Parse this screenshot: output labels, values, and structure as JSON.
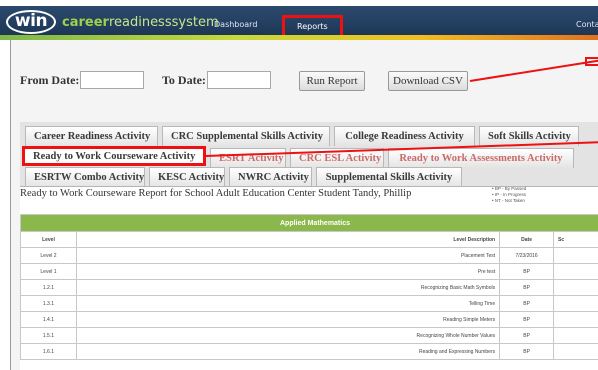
{
  "header": {
    "logo_text": "win",
    "brand_bold": "career",
    "brand_rest": "readinesssystem",
    "nav": [
      "Dashboard",
      "Reports",
      "Conta"
    ]
  },
  "filters": {
    "from_label": "From Date:",
    "to_label": "To Date:",
    "from_value": "",
    "to_value": "",
    "run_label": "Run Report",
    "csv_label": "Download CSV"
  },
  "tabs": {
    "row1": [
      "Career Readiness Activity",
      "CRC Supplemental Skills Activity",
      "College Readiness Activity",
      "Soft Skills Activity"
    ],
    "row2": [
      "Ready to Work Courseware Activity",
      "ESRT Activity",
      "CRC ESL Activity",
      "Ready to Work Assessments Activity"
    ],
    "row3": [
      "ESRTW Combo Activity",
      "KESC Activity",
      "NWRC Activity",
      "Supplemental Skills Activity"
    ]
  },
  "report": {
    "title": "Ready to Work Courseware Report for School Adult Education Center Student Tandy, Phillip",
    "legend": [
      "• BP - By Passed",
      "• IP - In Progress",
      "• NT - Not Taken"
    ]
  },
  "table": {
    "section": "Applied Mathematics",
    "headers": [
      "Level",
      "Level Description",
      "Date",
      "Sc"
    ],
    "rows": [
      {
        "level": "Level 2",
        "desc": "Placement Test",
        "date": "7/23/2016"
      },
      {
        "level": "Level 1",
        "desc": "Pre test",
        "date": "BP"
      },
      {
        "level": "1.2.1",
        "desc": "Recognizing Basic Math Symbols",
        "date": "BP"
      },
      {
        "level": "1.3.1",
        "desc": "Telling Time",
        "date": "BP"
      },
      {
        "level": "1.4.1",
        "desc": "Reading Simple Meters",
        "date": "BP"
      },
      {
        "level": "1.5.1",
        "desc": "Recognizing Whole Number Values",
        "date": "BP"
      },
      {
        "level": "1.6.1",
        "desc": "Reading and Expressing Numbers",
        "date": "BP"
      }
    ]
  },
  "colors": {
    "header": "#1b3352",
    "accent_green": "#8ab84a",
    "highlight_red": "#e11111"
  }
}
